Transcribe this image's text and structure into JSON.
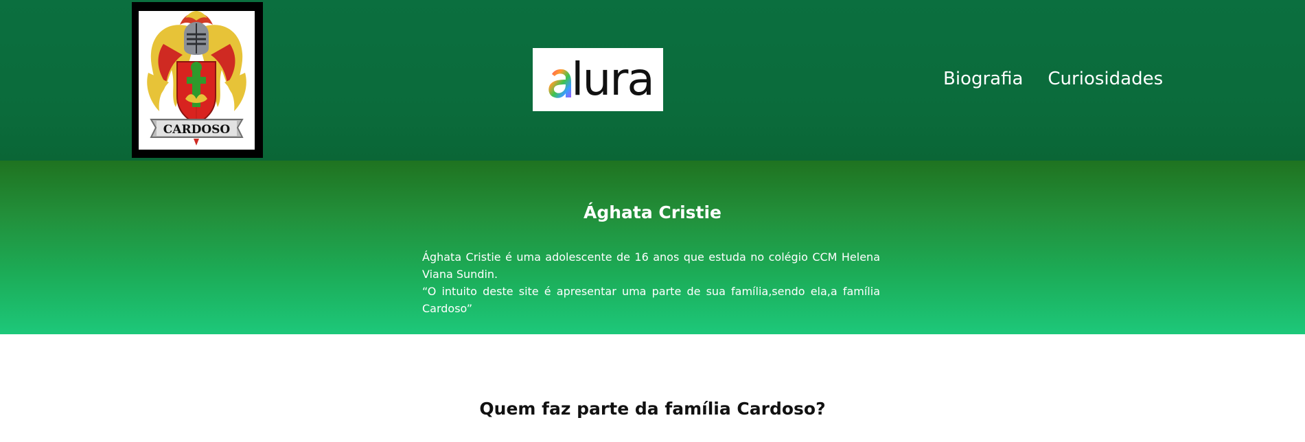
{
  "header": {
    "crest": {
      "icon": "family-crest-icon",
      "banner_text": "CARDOSO"
    },
    "brand": {
      "text": "lura",
      "leading_letter": "a",
      "accent_colors": [
        "#ff3f6c",
        "#ff9d2e",
        "#3fc44e",
        "#3a9cff",
        "#9b59ff"
      ]
    },
    "nav": [
      {
        "label": "Biografia"
      },
      {
        "label": "Curiosidades"
      }
    ],
    "background_color": "#0b6b3b"
  },
  "hero": {
    "title": "Ághata Cristie",
    "paragraph_1": "Ághata Cristie é uma adolescente de 16 anos que estuda no colégio CCM Helena Viana Sundin.",
    "paragraph_2": "“O intuito deste site é apresentar uma parte de sua família,sendo ela,a família Cardoso”",
    "gradient_colors": [
      "#1f7320",
      "#22903b",
      "#1cab56",
      "#1dc87a"
    ]
  },
  "family_section": {
    "title": "Quem faz parte da família Cardoso?"
  }
}
